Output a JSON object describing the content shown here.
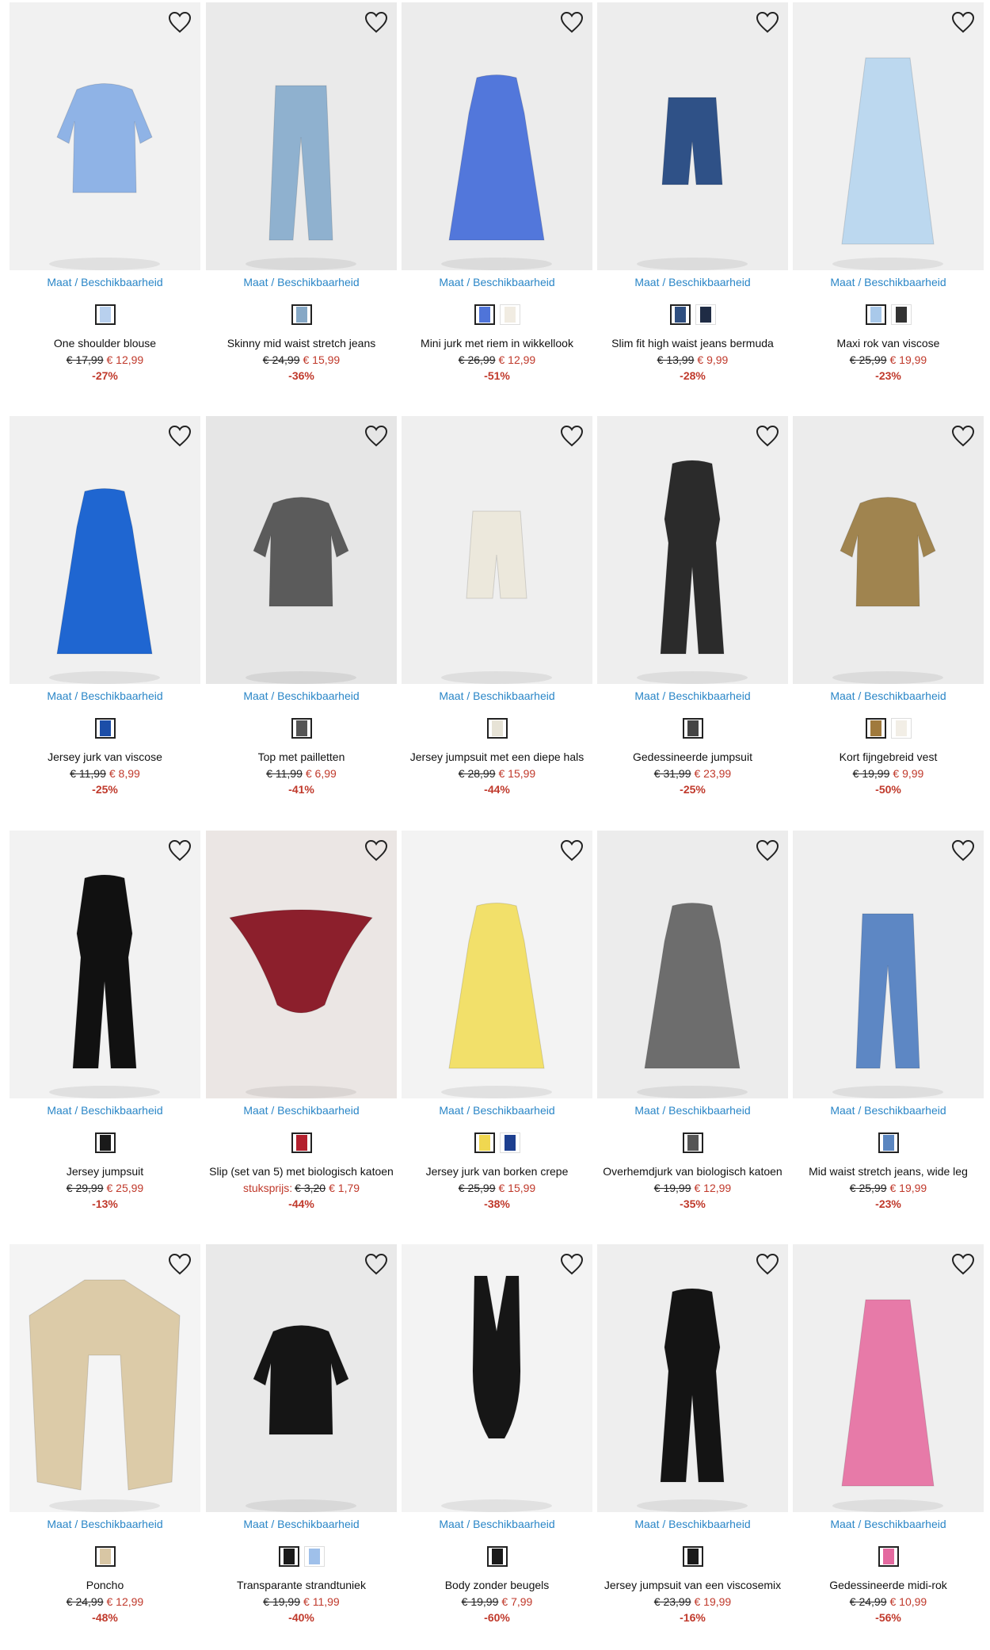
{
  "products": [
    {
      "image": "one-shoulder-blouse-image",
      "size_label": "Maat / Beschikbaarheid",
      "swatches": [
        "#b8d0ee"
      ],
      "name": "One shoulder blouse",
      "old_price": "€ 17,99",
      "price": "€ 12,99",
      "discount": "-27%",
      "bg": "#f1f1f1",
      "color": "#8fb3e6",
      "shape": "top"
    },
    {
      "image": "skinny-mid-waist-jeans-image",
      "size_label": "Maat / Beschikbaarheid",
      "swatches": [
        "#86a8c6"
      ],
      "name": "Skinny mid waist stretch jeans",
      "old_price": "€ 24,99",
      "price": "€ 15,99",
      "discount": "-36%",
      "bg": "#eaeaea",
      "color": "#8fb1cf",
      "shape": "pants"
    },
    {
      "image": "mini-wrap-dress-image",
      "size_label": "Maat / Beschikbaarheid",
      "swatches": [
        "#4f74d9",
        "#f1ece2"
      ],
      "name": "Mini jurk met riem in wikkellook",
      "old_price": "€ 26,99",
      "price": "€ 12,99",
      "discount": "-51%",
      "bg": "#ececec",
      "color": "#5277db",
      "shape": "dress"
    },
    {
      "image": "slim-fit-bermuda-image",
      "size_label": "Maat / Beschikbaarheid",
      "swatches": [
        "#2f4f80",
        "#1f2c45"
      ],
      "name": "Slim fit high waist jeans bermuda",
      "old_price": "€ 13,99",
      "price": "€ 9,99",
      "discount": "-28%",
      "bg": "#ededed",
      "color": "#2f5187",
      "shape": "shorts"
    },
    {
      "image": "maxi-viscose-skirt-image",
      "size_label": "Maat / Beschikbaarheid",
      "swatches": [
        "#a9c9ea",
        "#333333"
      ],
      "name": "Maxi rok van viscose",
      "old_price": "€ 25,99",
      "price": "€ 19,99",
      "discount": "-23%",
      "bg": "#f0f0f0",
      "color": "#bcd8ef",
      "shape": "skirt"
    },
    {
      "image": "jersey-viscose-dress-image",
      "size_label": "Maat / Beschikbaarheid",
      "swatches": [
        "#1c4ea8"
      ],
      "name": "Jersey jurk van viscose",
      "old_price": "€ 11,99",
      "price": "€ 8,99",
      "discount": "-25%",
      "bg": "#f0f0f0",
      "color": "#1f66d1",
      "shape": "dress"
    },
    {
      "image": "sequin-top-image",
      "size_label": "Maat / Beschikbaarheid",
      "swatches": [
        "#555555"
      ],
      "name": "Top met pailletten",
      "old_price": "€ 11,99",
      "price": "€ 6,99",
      "discount": "-41%",
      "bg": "#e6e6e6",
      "color": "#5b5b5b",
      "shape": "top"
    },
    {
      "image": "jersey-jumpsuit-deep-neck-image",
      "size_label": "Maat / Beschikbaarheid",
      "swatches": [
        "#e7e3d6"
      ],
      "name": "Jersey jumpsuit met een diepe hals",
      "old_price": "€ 28,99",
      "price": "€ 15,99",
      "discount": "-44%",
      "bg": "#efefef",
      "color": "#ece8dc",
      "shape": "shorts"
    },
    {
      "image": "patterned-jumpsuit-image",
      "size_label": "Maat / Beschikbaarheid",
      "swatches": [
        "#444444"
      ],
      "name": "Gedessineerde jumpsuit",
      "old_price": "€ 31,99",
      "price": "€ 23,99",
      "discount": "-25%",
      "bg": "#eeeeee",
      "color": "#2b2b2b",
      "shape": "jumpsuit"
    },
    {
      "image": "fine-knit-cardigan-image",
      "size_label": "Maat / Beschikbaarheid",
      "swatches": [
        "#a07a3d",
        "#f2eee6"
      ],
      "name": "Kort fijngebreid vest",
      "old_price": "€ 19,99",
      "price": "€ 9,99",
      "discount": "-50%",
      "bg": "#ececec",
      "color": "#a0844f",
      "shape": "top"
    },
    {
      "image": "jersey-jumpsuit-black-image",
      "size_label": "Maat / Beschikbaarheid",
      "swatches": [
        "#1a1a1a"
      ],
      "name": "Jersey jumpsuit",
      "old_price": "€ 29,99",
      "price": "€ 25,99",
      "discount": "-13%",
      "bg": "#f2f2f2",
      "color": "#111111",
      "shape": "jumpsuit"
    },
    {
      "image": "organic-cotton-slip-image",
      "size_label": "Maat / Beschikbaarheid",
      "swatches": [
        "#b3202e"
      ],
      "name": "Slip (set van 5) met biologisch katoen",
      "unit_label": "stuksprijs:",
      "old_price": "€ 3,20",
      "price": "€ 1,79",
      "discount": "-44%",
      "bg": "#ebe6e4",
      "color": "#8c1f2c",
      "shape": "brief"
    },
    {
      "image": "crepe-jersey-dress-image",
      "size_label": "Maat / Beschikbaarheid",
      "swatches": [
        "#f0d750",
        "#1d3f8f"
      ],
      "name": "Jersey jurk van borken crepe",
      "old_price": "€ 25,99",
      "price": "€ 15,99",
      "discount": "-38%",
      "bg": "#f3f3f3",
      "color": "#f2e06a",
      "shape": "dress"
    },
    {
      "image": "shirt-dress-organic-cotton-image",
      "size_label": "Maat / Beschikbaarheid",
      "swatches": [
        "#555555"
      ],
      "name": "Overhemdjurk van biologisch katoen",
      "old_price": "€ 19,99",
      "price": "€ 12,99",
      "discount": "-35%",
      "bg": "#ececec",
      "color": "#6d6d6d",
      "shape": "dress"
    },
    {
      "image": "wide-leg-jeans-image",
      "size_label": "Maat / Beschikbaarheid",
      "swatches": [
        "#5b86c0"
      ],
      "name": "Mid waist stretch jeans, wide leg",
      "old_price": "€ 25,99",
      "price": "€ 19,99",
      "discount": "-23%",
      "bg": "#efefef",
      "color": "#5d87c4",
      "shape": "pants"
    },
    {
      "image": "poncho-image",
      "size_label": "Maat / Beschikbaarheid",
      "swatches": [
        "#d8c6a4"
      ],
      "name": "Poncho",
      "old_price": "€ 24,99",
      "price": "€ 12,99",
      "discount": "-48%",
      "bg": "#f4f4f4",
      "color": "#dccba8",
      "shape": "poncho"
    },
    {
      "image": "beach-tunic-image",
      "size_label": "Maat / Beschikbaarheid",
      "swatches": [
        "#1a1a1a",
        "#9fc0ea"
      ],
      "name": "Transparante strandtuniek",
      "old_price": "€ 19,99",
      "price": "€ 11,99",
      "discount": "-40%",
      "bg": "#e9e9e9",
      "color": "#151515",
      "shape": "top"
    },
    {
      "image": "bodysuit-image",
      "size_label": "Maat / Beschikbaarheid",
      "swatches": [
        "#1a1a1a"
      ],
      "name": "Body zonder beugels",
      "old_price": "€ 19,99",
      "price": "€ 7,99",
      "discount": "-60%",
      "bg": "#f3f3f3",
      "color": "#161616",
      "shape": "body"
    },
    {
      "image": "viscose-jersey-jumpsuit-image",
      "size_label": "Maat / Beschikbaarheid",
      "swatches": [
        "#1a1a1a"
      ],
      "name": "Jersey jumpsuit van een viscosemix",
      "old_price": "€ 23,99",
      "price": "€ 19,99",
      "discount": "-16%",
      "bg": "#eeeeee",
      "color": "#141414",
      "shape": "jumpsuit"
    },
    {
      "image": "patterned-midi-skirt-image",
      "size_label": "Maat / Beschikbaarheid",
      "swatches": [
        "#e46aa0"
      ],
      "name": "Gedessineerde midi-rok",
      "old_price": "€ 24,99",
      "price": "€ 10,99",
      "discount": "-56%",
      "bg": "#efefef",
      "color": "#e77aa8",
      "shape": "skirt"
    }
  ]
}
